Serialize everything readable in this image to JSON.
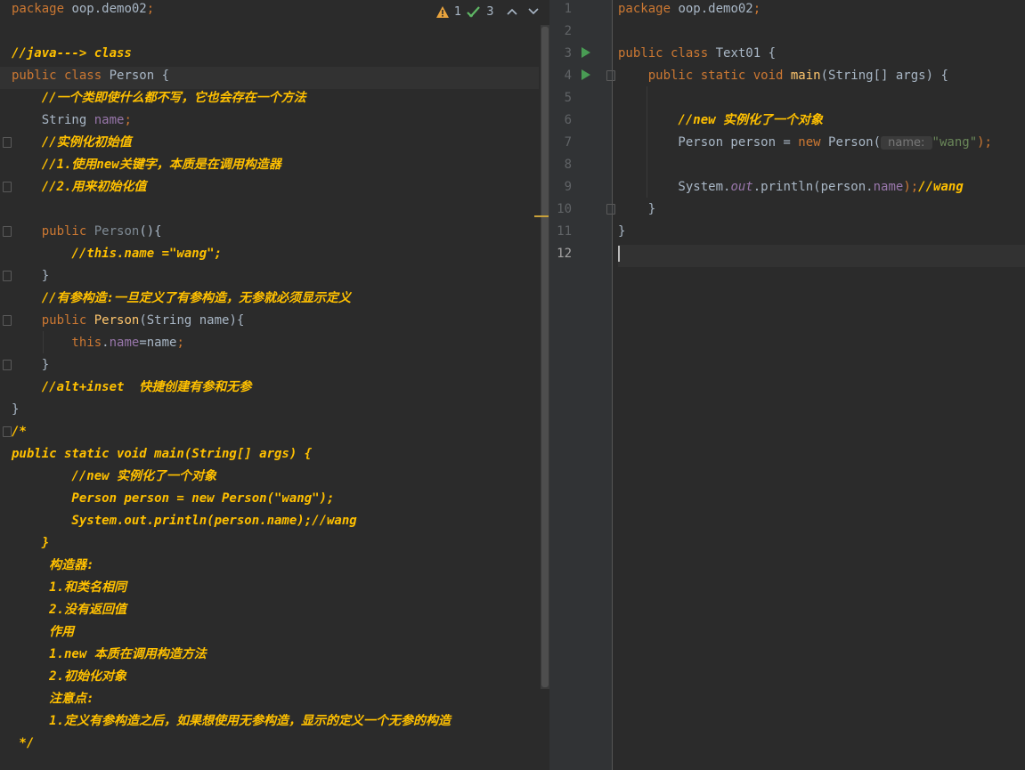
{
  "inspection": {
    "warnings": "1",
    "ok": "3"
  },
  "left_lines": [
    [
      {
        "t": "package",
        "c": "kw"
      },
      {
        "t": " oop.demo02",
        "c": ""
      },
      {
        "t": ";",
        "c": "kw"
      }
    ],
    [],
    [
      {
        "t": "//java---> class",
        "c": "cm"
      }
    ],
    [
      {
        "t": "public class",
        "c": "kw"
      },
      {
        "t": " Person {",
        "c": ""
      }
    ],
    [
      {
        "t": "    //一个类即使什么都不写，它也会存在一个方法",
        "c": "cm"
      }
    ],
    [
      {
        "t": "    String ",
        "c": ""
      },
      {
        "t": "name",
        "c": "fld"
      },
      {
        "t": ";",
        "c": "kw"
      }
    ],
    [
      {
        "t": "    //实例化初始值",
        "c": "cm"
      }
    ],
    [
      {
        "t": "    //1.使用new关键字，本质是在调用构造器",
        "c": "cm"
      }
    ],
    [
      {
        "t": "    //2.用来初始化值",
        "c": "cm"
      }
    ],
    [],
    [
      {
        "t": "    public",
        "c": "kw"
      },
      {
        "t": " Person",
        "c": "cls-dim"
      },
      {
        "t": "(){",
        "c": ""
      }
    ],
    [
      {
        "t": "        //this.name =\"wang\";",
        "c": "cm"
      }
    ],
    [
      {
        "t": "    }",
        "c": ""
      }
    ],
    [
      {
        "t": "    //有参构造:一旦定义了有参构造，无参就必须显示定义",
        "c": "cm"
      }
    ],
    [
      {
        "t": "    public",
        "c": "kw"
      },
      {
        "t": " Person",
        "c": "fn"
      },
      {
        "t": "(String name){",
        "c": ""
      }
    ],
    [
      {
        "t": "        this",
        "c": "kw"
      },
      {
        "t": ".",
        "c": ""
      },
      {
        "t": "name",
        "c": "fld"
      },
      {
        "t": "=name",
        "c": ""
      },
      {
        "t": ";",
        "c": "kw"
      }
    ],
    [
      {
        "t": "    }",
        "c": ""
      }
    ],
    [
      {
        "t": "    //alt+inset  快捷创建有参和无参",
        "c": "cm"
      }
    ],
    [
      {
        "t": "}",
        "c": ""
      }
    ],
    [
      {
        "t": "/*",
        "c": "cm"
      }
    ],
    [
      {
        "t": "public static void main(String[] args) {",
        "c": "cm"
      }
    ],
    [
      {
        "t": "        //new 实例化了一个对象",
        "c": "cm"
      }
    ],
    [
      {
        "t": "        Person person = new Person(\"wang\");",
        "c": "cm"
      }
    ],
    [
      {
        "t": "        System.out.println(person.name);//wang",
        "c": "cm"
      }
    ],
    [
      {
        "t": "    }",
        "c": "cm"
      }
    ],
    [
      {
        "t": "     构造器:",
        "c": "cm"
      }
    ],
    [
      {
        "t": "     1.和类名相同",
        "c": "cm"
      }
    ],
    [
      {
        "t": "     2.没有返回值",
        "c": "cm"
      }
    ],
    [
      {
        "t": "     作用",
        "c": "cm"
      }
    ],
    [
      {
        "t": "     1.new 本质在调用构造方法",
        "c": "cm"
      }
    ],
    [
      {
        "t": "     2.初始化对象",
        "c": "cm"
      }
    ],
    [
      {
        "t": "     注意点:",
        "c": "cm"
      }
    ],
    [
      {
        "t": "     1.定义有参构造之后，如果想使用无参构造，显示的定义一个无参的构造",
        "c": "cm"
      }
    ],
    [
      {
        "t": " */",
        "c": "cm"
      }
    ]
  ],
  "right_line_numbers": [
    "1",
    "2",
    "3",
    "4",
    "5",
    "6",
    "7",
    "8",
    "9",
    "10",
    "11",
    "12"
  ],
  "right_lines": [
    [
      {
        "t": "package",
        "c": "kw"
      },
      {
        "t": " oop.demo02",
        "c": ""
      },
      {
        "t": ";",
        "c": "kw"
      }
    ],
    [],
    [
      {
        "t": "public class",
        "c": "kw"
      },
      {
        "t": " Text01 {",
        "c": ""
      }
    ],
    [
      {
        "t": "    public static void",
        "c": "kw"
      },
      {
        "t": " ",
        "c": ""
      },
      {
        "t": "main",
        "c": "fn"
      },
      {
        "t": "(String[] args) {",
        "c": ""
      }
    ],
    [],
    [
      {
        "t": "        //new 实例化了一个对象",
        "c": "cm"
      }
    ],
    [
      {
        "t": "        Person person = ",
        "c": ""
      },
      {
        "t": "new",
        "c": "kw"
      },
      {
        "t": " Person(",
        "c": ""
      },
      {
        "t": " name: ",
        "c": "hint"
      },
      {
        "t": "\"wang\"",
        "c": "str"
      },
      {
        "t": ");",
        "c": "kw"
      }
    ],
    [],
    [
      {
        "t": "        System.",
        "c": ""
      },
      {
        "t": "out",
        "c": "italic-field"
      },
      {
        "t": ".println(person.",
        "c": ""
      },
      {
        "t": "name",
        "c": "fld"
      },
      {
        "t": ");",
        "c": "kw"
      },
      {
        "t": "//wang",
        "c": "cm"
      }
    ],
    [
      {
        "t": "    }",
        "c": ""
      }
    ],
    [
      {
        "t": "}",
        "c": ""
      }
    ],
    []
  ]
}
